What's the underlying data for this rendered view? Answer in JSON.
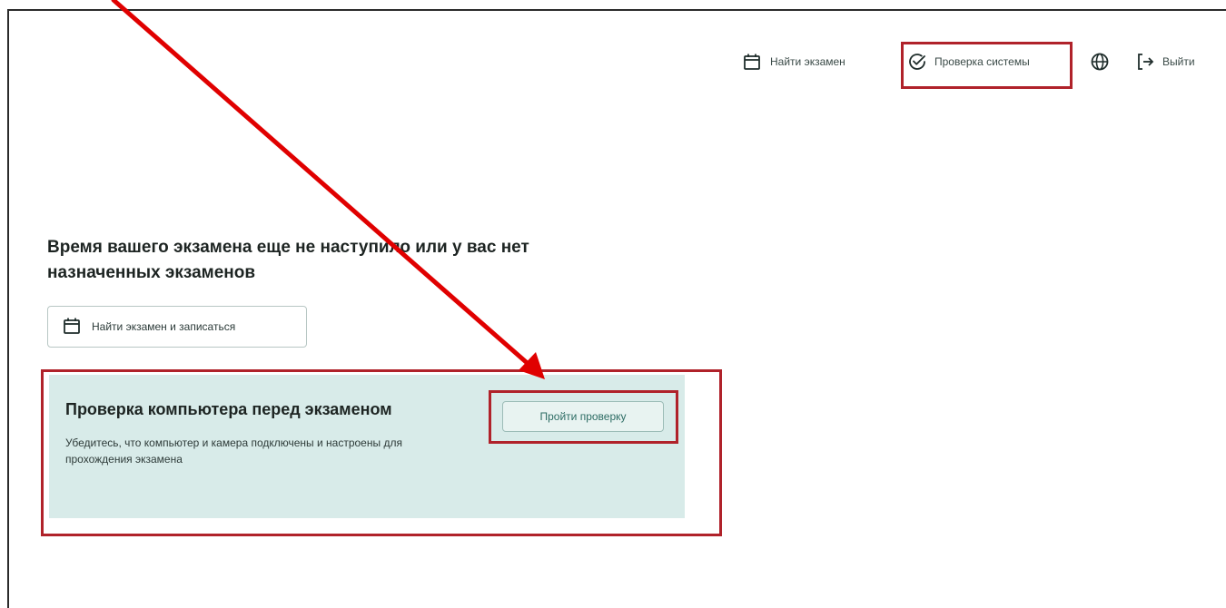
{
  "nav": {
    "find_exam": "Найти экзамен",
    "system_check": "Проверка системы",
    "language_icon": "globe-icon",
    "logout": "Выйти"
  },
  "main": {
    "headline": "Время вашего экзамена еще не наступило или у вас нет назначенных экзаменов",
    "find_and_register_button": "Найти экзамен и записаться"
  },
  "check_card": {
    "title": "Проверка компьютера перед экзаменом",
    "description": "Убедитесь, что компьютер и камера подключены и настроены для прохождения экзамена",
    "button": "Пройти проверку"
  },
  "colors": {
    "annotation_red": "#b0222a",
    "arrow_red": "#e00000",
    "card_bg": "#d8ebe9",
    "accent": "#2d6c64"
  }
}
